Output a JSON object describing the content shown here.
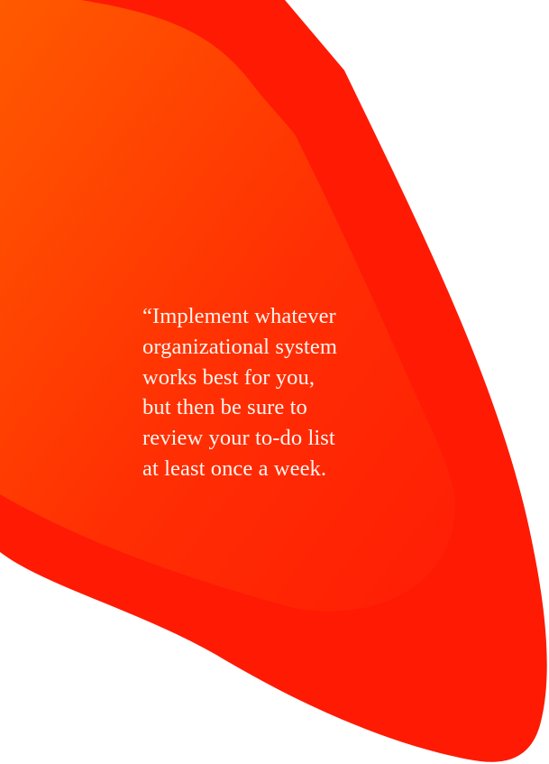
{
  "quote": {
    "lines": [
      "“Implement whatever",
      "organizational system",
      "works best for you,",
      "but then be sure to",
      "review your to-do list",
      "at least once a week."
    ]
  },
  "colors": {
    "outer_blob": "#ff1a04",
    "inner_gradient_start": "#ff5a00",
    "inner_gradient_end": "#ff1d05",
    "quote_text": "#fff5ee",
    "background": "#ffffff"
  }
}
